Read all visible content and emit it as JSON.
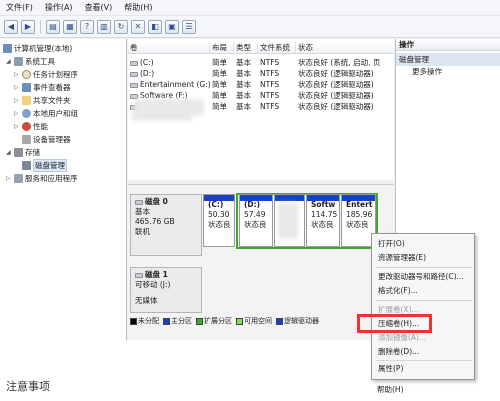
{
  "menubar": [
    "文件(F)",
    "操作(A)",
    "查看(V)",
    "帮助(H)"
  ],
  "tree": {
    "root": "计算机管理(本地)",
    "system_tools": "系统工具",
    "task_scheduler": "任务计划程序",
    "event_viewer": "事件查看器",
    "shared_folders": "共享文件夹",
    "local_users": "本地用户和组",
    "performance": "性能",
    "device_manager": "设备管理器",
    "storage": "存储",
    "disk_management": "磁盘管理",
    "services_apps": "服务和应用程序"
  },
  "list": {
    "headers": [
      "卷",
      "布局",
      "类型",
      "文件系统",
      "状态"
    ],
    "rows": [
      {
        "volume": "(C:)",
        "layout": "简单",
        "type": "基本",
        "fs": "NTFS",
        "status": "状态良好 (系统, 启动, 页"
      },
      {
        "volume": "(D:)",
        "layout": "简单",
        "type": "基本",
        "fs": "NTFS",
        "status": "状态良好 (逻辑驱动器)"
      },
      {
        "volume": "Entertainment (G:)",
        "layout": "简单",
        "type": "基本",
        "fs": "NTFS",
        "status": "状态良好 (逻辑驱动器)"
      },
      {
        "volume": "Software (F:)",
        "layout": "简单",
        "type": "基本",
        "fs": "NTFS",
        "status": "状态良好 (逻辑驱动器)"
      },
      {
        "volume": "",
        "layout": "简单",
        "type": "基本",
        "fs": "NTFS",
        "status": "状态良好 (逻辑驱动器)"
      }
    ]
  },
  "disk0": {
    "name": "磁盘 0",
    "kind": "基本",
    "size": "465.76 GB",
    "state": "联机",
    "volumes": [
      {
        "label": "(C:)",
        "size": "50.30",
        "status": "状态良"
      },
      {
        "label": "(D:)",
        "size": "57.49",
        "status": "状态良"
      },
      {
        "label": "",
        "size": "",
        "status": ""
      },
      {
        "label": "Softw",
        "size": "114.75",
        "status": "状态良"
      },
      {
        "label": "Entert",
        "size": "185.96",
        "status": "状态良"
      }
    ]
  },
  "disk1": {
    "name": "磁盘 1",
    "kind": "可移动 (J:)",
    "media": "无媒体"
  },
  "legend": [
    {
      "label": "未分配",
      "color": "#000000"
    },
    {
      "label": "主分区",
      "color": "#1c3fc4"
    },
    {
      "label": "扩展分区",
      "color": "#3ea82c"
    },
    {
      "label": "可用空间",
      "color": "#7ee05a"
    },
    {
      "label": "逻辑驱动器",
      "color": "#1c3fc4"
    }
  ],
  "actions": {
    "title": "操作",
    "section": "磁盘管理",
    "more": "更多操作"
  },
  "context_menu": {
    "open": "打开(O)",
    "explore": "资源管理器(E)",
    "change_letter": "更改驱动器号和路径(C)...",
    "format": "格式化(F)...",
    "extend": "扩展卷(X)...",
    "shrink": "压缩卷(H)...",
    "add_mirror": "添加镜像(A)...",
    "delete": "删除卷(D)...",
    "properties": "属性(P)",
    "help": "帮助(H)"
  },
  "notes_heading": "注意事项",
  "colors": {
    "accent_highlight": "#e8372c",
    "partition_blue": "#1c3fc4",
    "extended_green": "#3ea82c"
  }
}
